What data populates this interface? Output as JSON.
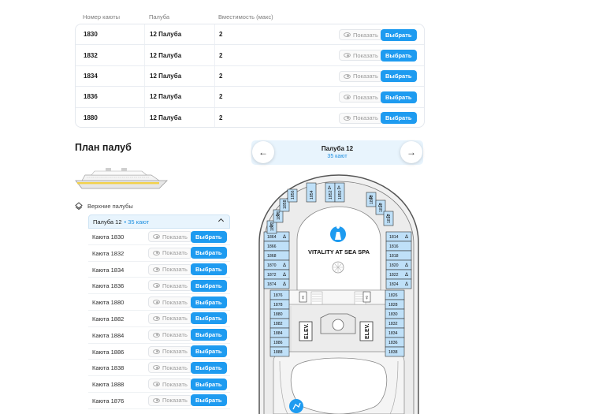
{
  "table": {
    "headers": [
      "Номер каюты",
      "Палуба",
      "Вместимость (макс)"
    ],
    "rows": [
      {
        "cabin": "1830",
        "deck": "12 Палуба",
        "capacity": "2"
      },
      {
        "cabin": "1832",
        "deck": "12 Палуба",
        "capacity": "2"
      },
      {
        "cabin": "1834",
        "deck": "12 Палуба",
        "capacity": "2"
      },
      {
        "cabin": "1836",
        "deck": "12 Палуба",
        "capacity": "2"
      },
      {
        "cabin": "1880",
        "deck": "12 Палуба",
        "capacity": "2"
      }
    ],
    "show_label": "Показать",
    "select_label": "Выбрать"
  },
  "plan": {
    "title": "План палуб",
    "upper_decks_label": "Верхние палубы",
    "deck_label": "Палуба 12",
    "deck_count": "35 кают",
    "cabins": [
      "Каюта 1830",
      "Каюта 1832",
      "Каюта 1834",
      "Каюта 1836",
      "Каюта 1880",
      "Каюта 1882",
      "Каюта 1884",
      "Каюта 1886",
      "Каюта 1838",
      "Каюта 1888",
      "Каюта 1876"
    ],
    "show_label": "Показать",
    "select_label": "Выбрать"
  },
  "deck_nav": {
    "title": "Палуба 12",
    "subtitle": "35 кают"
  },
  "map": {
    "spa_label": "VITALITY AT SEA SPA",
    "elevator_label": "ELEV.",
    "left_cabins": [
      "1864",
      "1866",
      "1868",
      "1870",
      "1872",
      "1874"
    ],
    "right_cabins": [
      "1814",
      "1816",
      "1818",
      "1820",
      "1822",
      "1824"
    ],
    "left_lower_cabins": [
      "1876",
      "1878",
      "1880",
      "1882",
      "1884",
      "1886",
      "1888"
    ],
    "right_lower_cabins": [
      "1826",
      "1828",
      "1830",
      "1832",
      "1834",
      "1836",
      "1838"
    ],
    "arc_left": [
      "1862",
      "1860",
      "1858",
      "1856"
    ],
    "arc_top": [
      "1854",
      "1852",
      "1850"
    ],
    "arc_right": [
      "1808",
      "1810",
      "1812"
    ],
    "accent_color": "#1e9bf0",
    "cabin_fill": "#bfe0f8"
  }
}
